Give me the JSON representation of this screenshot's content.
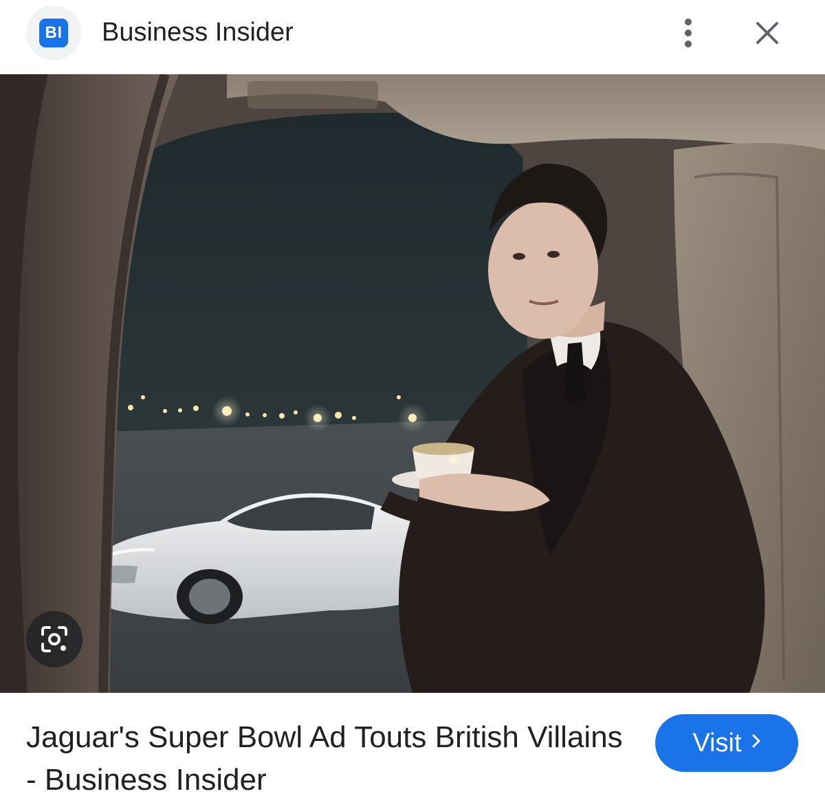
{
  "header": {
    "logo_text": "BI",
    "source_name": "Business Insider",
    "more_icon": "more-vert-icon",
    "close_icon": "close-icon"
  },
  "image": {
    "lens_icon": "lens-search-icon"
  },
  "footer": {
    "title": "Jaguar's Super Bowl Ad Touts British Villains - Business Insider",
    "visit_label": "Visit",
    "visit_icon": "chevron-right-icon"
  },
  "colors": {
    "accent": "#1a73e8",
    "text": "#202124",
    "logo_bg": "#f1f3f4"
  }
}
